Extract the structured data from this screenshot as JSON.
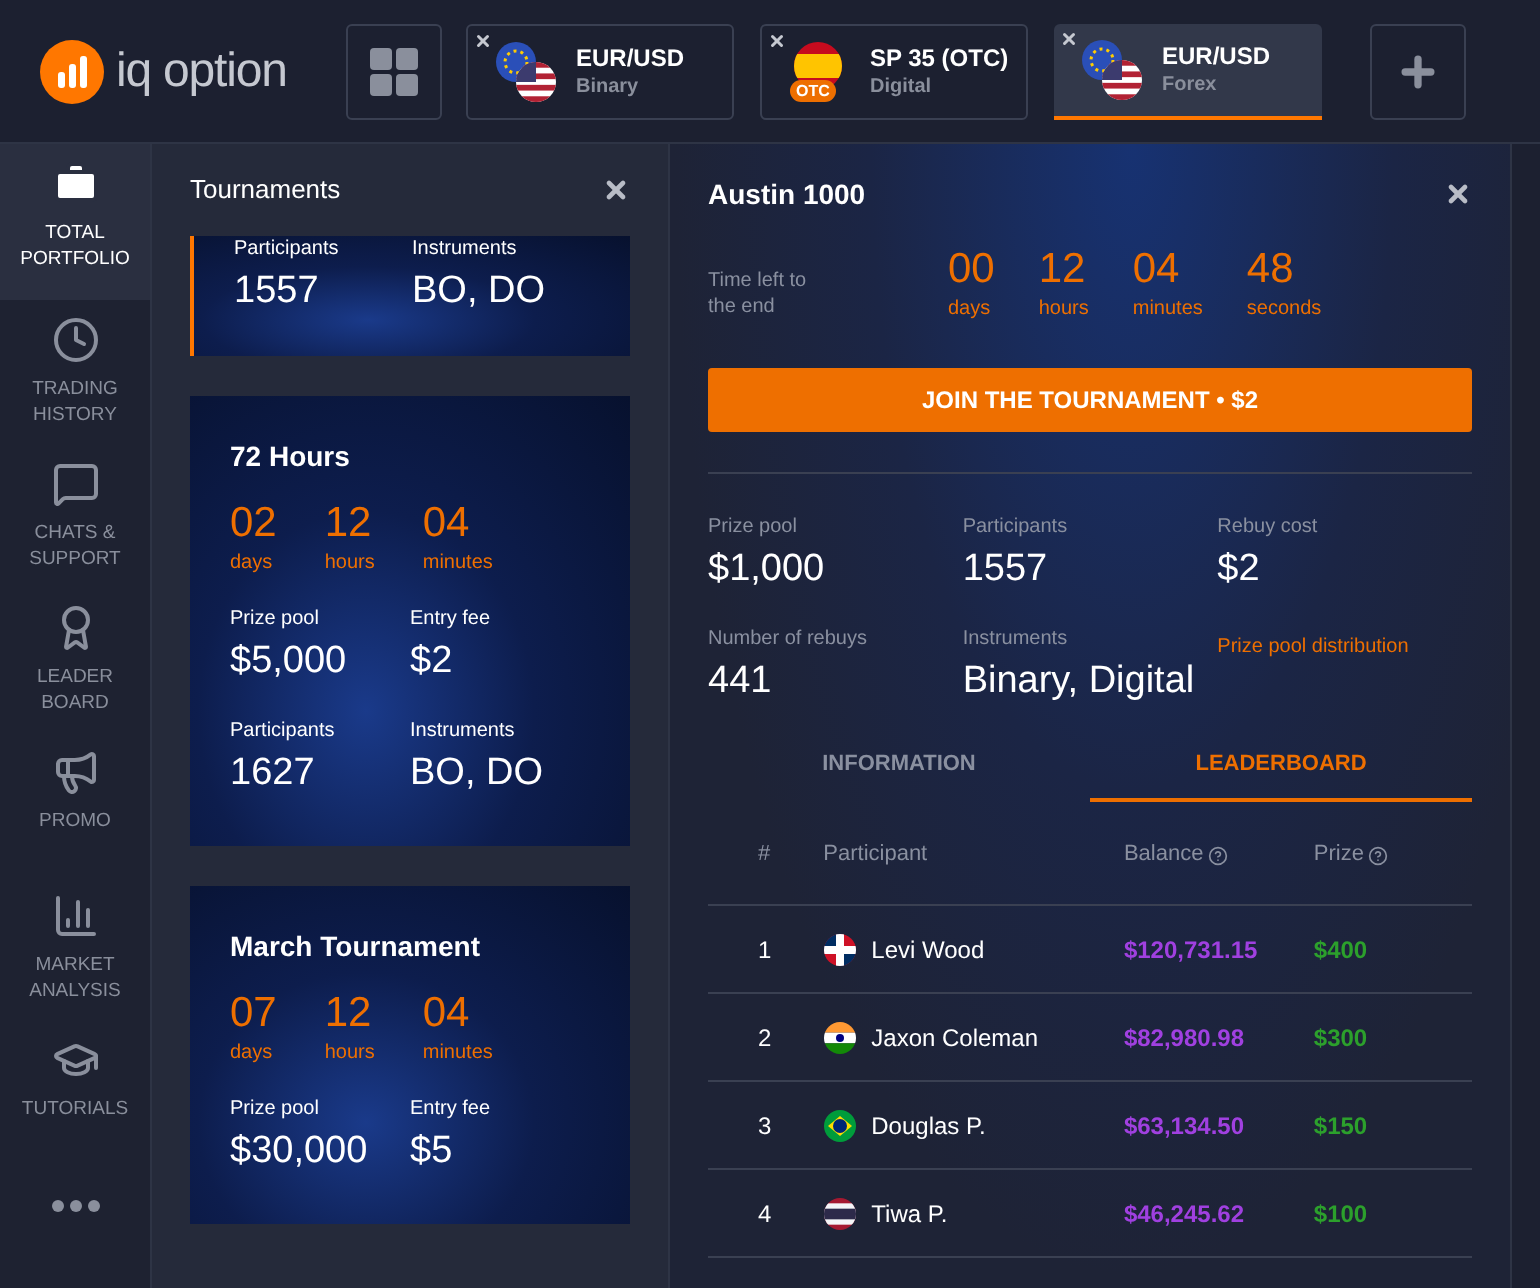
{
  "header": {
    "logo": "iq option",
    "asset_tabs": [
      {
        "pair": "EUR/USD",
        "type": "Binary",
        "kind": "eu-us",
        "selected": false
      },
      {
        "pair": "SP 35 (OTC)",
        "type": "Digital",
        "kind": "es-otc",
        "badge": "OTC",
        "selected": false
      },
      {
        "pair": "EUR/USD",
        "type": "Forex",
        "kind": "eu-us",
        "selected": true
      }
    ]
  },
  "sidebar": {
    "items": [
      {
        "label": "TOTAL PORTFOLIO",
        "kind": "briefcase",
        "selected": true
      },
      {
        "label": "TRADING HISTORY",
        "kind": "clock",
        "selected": false
      },
      {
        "label": "CHATS & SUPPORT",
        "kind": "chat",
        "selected": false
      },
      {
        "label": "LEADER BOARD",
        "kind": "award",
        "selected": false
      },
      {
        "label": "PROMO",
        "kind": "megaphone",
        "selected": false
      },
      {
        "label": "MARKET ANALYSIS",
        "kind": "chart",
        "selected": false
      },
      {
        "label": "TUTORIALS",
        "kind": "cap",
        "selected": false
      },
      {
        "kind": "more",
        "selected": false
      }
    ]
  },
  "tournaments": {
    "title": "Tournaments",
    "cards": [
      {
        "selected": true,
        "stats": [
          {
            "label": "Participants",
            "value": "1557"
          },
          {
            "label": "Instruments",
            "value": "BO, DO"
          }
        ]
      },
      {
        "selected": false,
        "title": "72 Hours",
        "countdown": [
          {
            "value": "02",
            "unit": "days"
          },
          {
            "value": "12",
            "unit": "hours"
          },
          {
            "value": "04",
            "unit": "minutes"
          }
        ],
        "stats": [
          {
            "label": "Prize pool",
            "value": "$5,000"
          },
          {
            "label": "Entry fee",
            "value": "$2"
          },
          {
            "label": "Participants",
            "value": "1627"
          },
          {
            "label": "Instruments",
            "value": "BO, DO"
          }
        ]
      },
      {
        "selected": false,
        "title": "March Tournament",
        "countdown": [
          {
            "value": "07",
            "unit": "days"
          },
          {
            "value": "12",
            "unit": "hours"
          },
          {
            "value": "04",
            "unit": "minutes"
          }
        ],
        "stats": [
          {
            "label": "Prize pool",
            "value": "$30,000"
          },
          {
            "label": "Entry fee",
            "value": "$5"
          }
        ]
      }
    ]
  },
  "detail": {
    "title": "Austin 1000",
    "time_left_label": "Time left to the end",
    "countdown": [
      {
        "value": "00",
        "unit": "days"
      },
      {
        "value": "12",
        "unit": "hours"
      },
      {
        "value": "04",
        "unit": "minutes"
      },
      {
        "value": "48",
        "unit": "seconds"
      }
    ],
    "join_button": "JOIN THE TOURNAMENT • $2",
    "stats": [
      {
        "label": "Prize pool",
        "value": "$1,000"
      },
      {
        "label": "Participants",
        "value": "1557"
      },
      {
        "label": "Rebuy cost",
        "value": "$2"
      },
      {
        "label": "Number of rebuys",
        "value": "441"
      },
      {
        "label": "Instruments",
        "value": "Binary, Digital"
      }
    ],
    "distribution_link": "Prize pool distribution",
    "tabs": [
      {
        "label": "INFORMATION",
        "selected": false
      },
      {
        "label": "LEADERBOARD",
        "selected": true
      }
    ],
    "table": {
      "columns": [
        {
          "label": "#",
          "help": false
        },
        {
          "label": "Participant",
          "help": false
        },
        {
          "label": "Balance",
          "help": true
        },
        {
          "label": "Prize",
          "help": true
        }
      ],
      "rows": [
        {
          "rank": "1",
          "kind": "do",
          "name": "Levi Wood",
          "balance": "$120,731.15",
          "prize": "$400"
        },
        {
          "rank": "2",
          "kind": "in",
          "name": "Jaxon Coleman",
          "balance": "$82,980.98",
          "prize": "$300"
        },
        {
          "rank": "3",
          "kind": "br",
          "name": "Douglas P.",
          "balance": "$63,134.50",
          "prize": "$150"
        },
        {
          "rank": "4",
          "kind": "th",
          "name": "Tiwa P.",
          "balance": "$46,245.62",
          "prize": "$100"
        }
      ]
    }
  }
}
